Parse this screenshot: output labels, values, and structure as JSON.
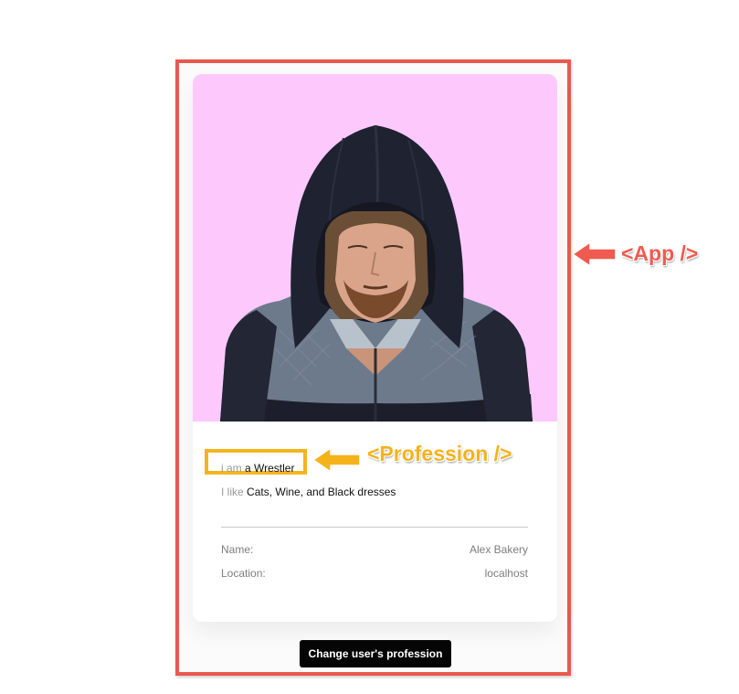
{
  "profile": {
    "profession_prefix": "i am",
    "profession_value": "a Wrestler",
    "likes_prefix": "I like",
    "likes_value": "Cats, Wine, and Black dresses",
    "details": [
      {
        "label": "Name:",
        "value": "Alex Bakery"
      },
      {
        "label": "Location:",
        "value": "localhost"
      }
    ]
  },
  "actions": {
    "change_profession_label": "Change user's profession"
  },
  "annotations": {
    "app_label": "<App />",
    "profession_label": "<Profession />"
  },
  "colors": {
    "app_outline": "#e8594f",
    "profession_outline": "#f2b51c",
    "photo_background": "#fdc9fd",
    "button_background": "#050505"
  },
  "icons": {
    "app_arrow": "arrow-left-icon",
    "profession_arrow": "arrow-left-icon"
  }
}
